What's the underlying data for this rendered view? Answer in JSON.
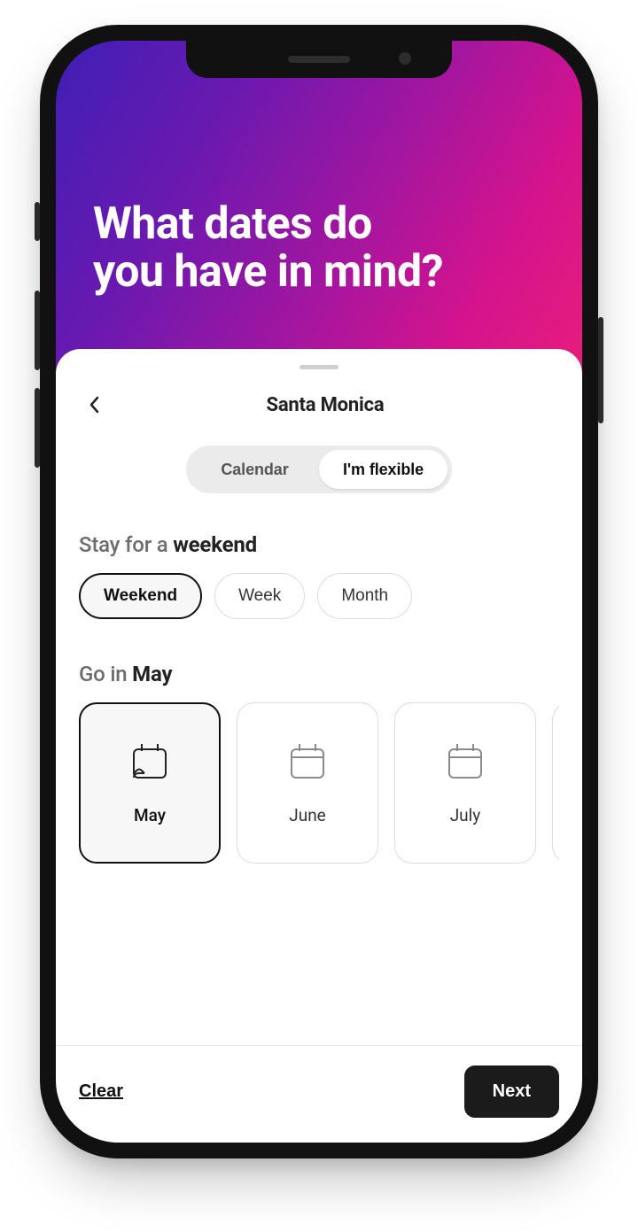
{
  "hero": {
    "title_line1": "What dates do",
    "title_line2": "you have in mind?"
  },
  "nav": {
    "location": "Santa Monica"
  },
  "tabs": {
    "calendar": "Calendar",
    "flexible": "I'm flexible",
    "active": "flexible"
  },
  "stay": {
    "label_prefix": "Stay for a ",
    "label_value": "weekend",
    "options": {
      "weekend": "Weekend",
      "week": "Week",
      "month": "Month"
    },
    "selected": "weekend"
  },
  "go": {
    "label_prefix": "Go in ",
    "label_value": "May",
    "months": {
      "may": "May",
      "june": "June",
      "july": "July"
    },
    "selected": "may"
  },
  "footer": {
    "clear": "Clear",
    "next": "Next"
  }
}
